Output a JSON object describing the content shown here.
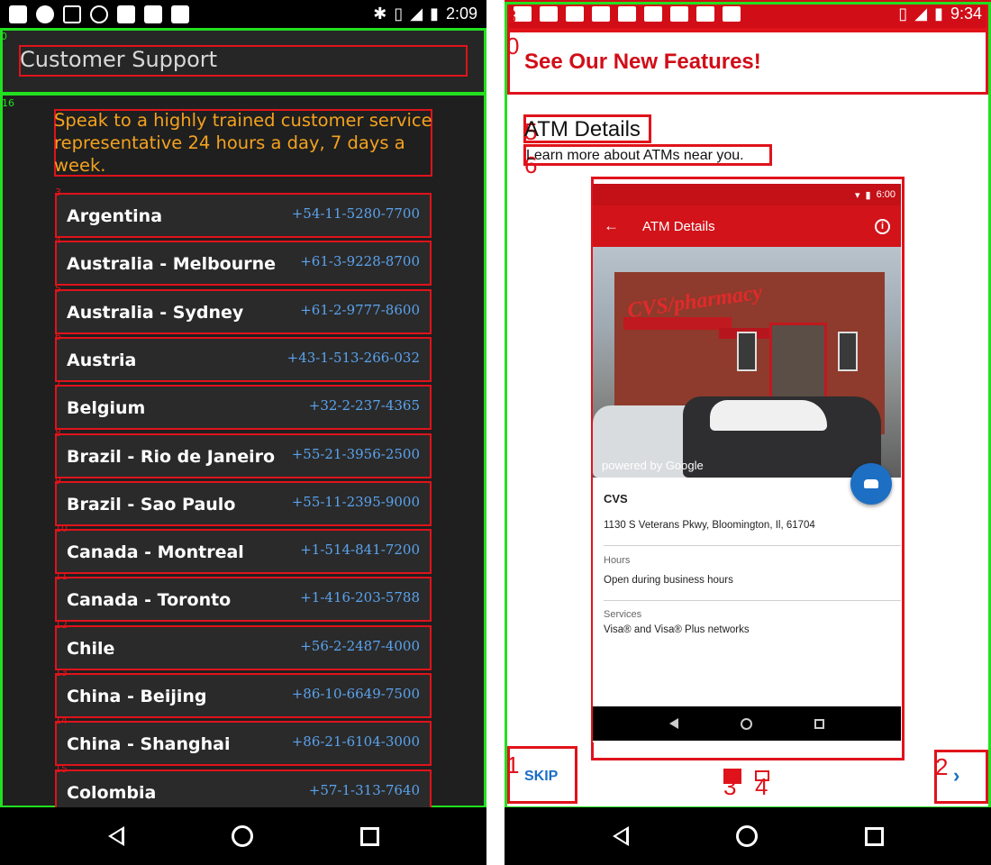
{
  "left_phone": {
    "statusbar": {
      "time": "2:09"
    },
    "header": {
      "title": "Customer Support"
    },
    "intro": "Speak to a highly trained customer service representative 24 hours a day, 7 days a week.",
    "contacts": [
      {
        "country": "Argentina",
        "phone": "+54-11-5280-7700",
        "tag": "3"
      },
      {
        "country": "Australia - Melbourne",
        "phone": "+61-3-9228-8700",
        "tag": "4"
      },
      {
        "country": "Australia - Sydney",
        "phone": "+61-2-9777-8600",
        "tag": "5"
      },
      {
        "country": "Austria",
        "phone": "+43-1-513-266-032",
        "tag": "6"
      },
      {
        "country": "Belgium",
        "phone": "+32-2-237-4365",
        "tag": "7"
      },
      {
        "country": "Brazil - Rio de Janeiro",
        "phone": "+55-21-3956-2500",
        "tag": "8"
      },
      {
        "country": "Brazil - Sao Paulo",
        "phone": "+55-11-2395-9000",
        "tag": "9"
      },
      {
        "country": "Canada - Montreal",
        "phone": "+1-514-841-7200",
        "tag": "10"
      },
      {
        "country": "Canada - Toronto",
        "phone": "+1-416-203-5788",
        "tag": "11"
      },
      {
        "country": "Chile",
        "phone": "+56-2-2487-4000",
        "tag": "12"
      },
      {
        "country": "China - Beijing",
        "phone": "+86-10-6649-7500",
        "tag": "13"
      },
      {
        "country": "China - Shanghai",
        "phone": "+86-21-6104-3000",
        "tag": "14"
      },
      {
        "country": "Colombia",
        "phone": "+57-1-313-7640",
        "tag": "15"
      }
    ],
    "tags": {
      "header": "0",
      "list": "16"
    }
  },
  "right_phone": {
    "statusbar": {
      "time": "9:34"
    },
    "header": {
      "title": "See Our New Features!"
    },
    "feature_title": "ATM Details",
    "feature_subtitle": "Learn more about ATMs near you.",
    "screenshot": {
      "statusbar_time": "6:00",
      "appbar_title": "ATM Details",
      "back_arrow": "←",
      "info_glyph": "i",
      "photo_brand": "CVS/pharmacy",
      "photo_credit": "powered by Google",
      "place_name": "CVS",
      "address": "1130 S Veterans Pkwy, Bloomington, Il, 61704",
      "hours_label": "Hours",
      "hours_value": "Open during business hours",
      "services_label": "Services",
      "services_value": "Visa® and Visa® Plus networks"
    },
    "skip_label": "SKIP",
    "next_glyph": "›",
    "tags": {
      "statusbar": "8",
      "header": "0",
      "title": "5",
      "subtitle": "6",
      "image": "7",
      "skip": "1",
      "next": "2",
      "dot_active": "3",
      "dot_inactive": "4"
    }
  }
}
